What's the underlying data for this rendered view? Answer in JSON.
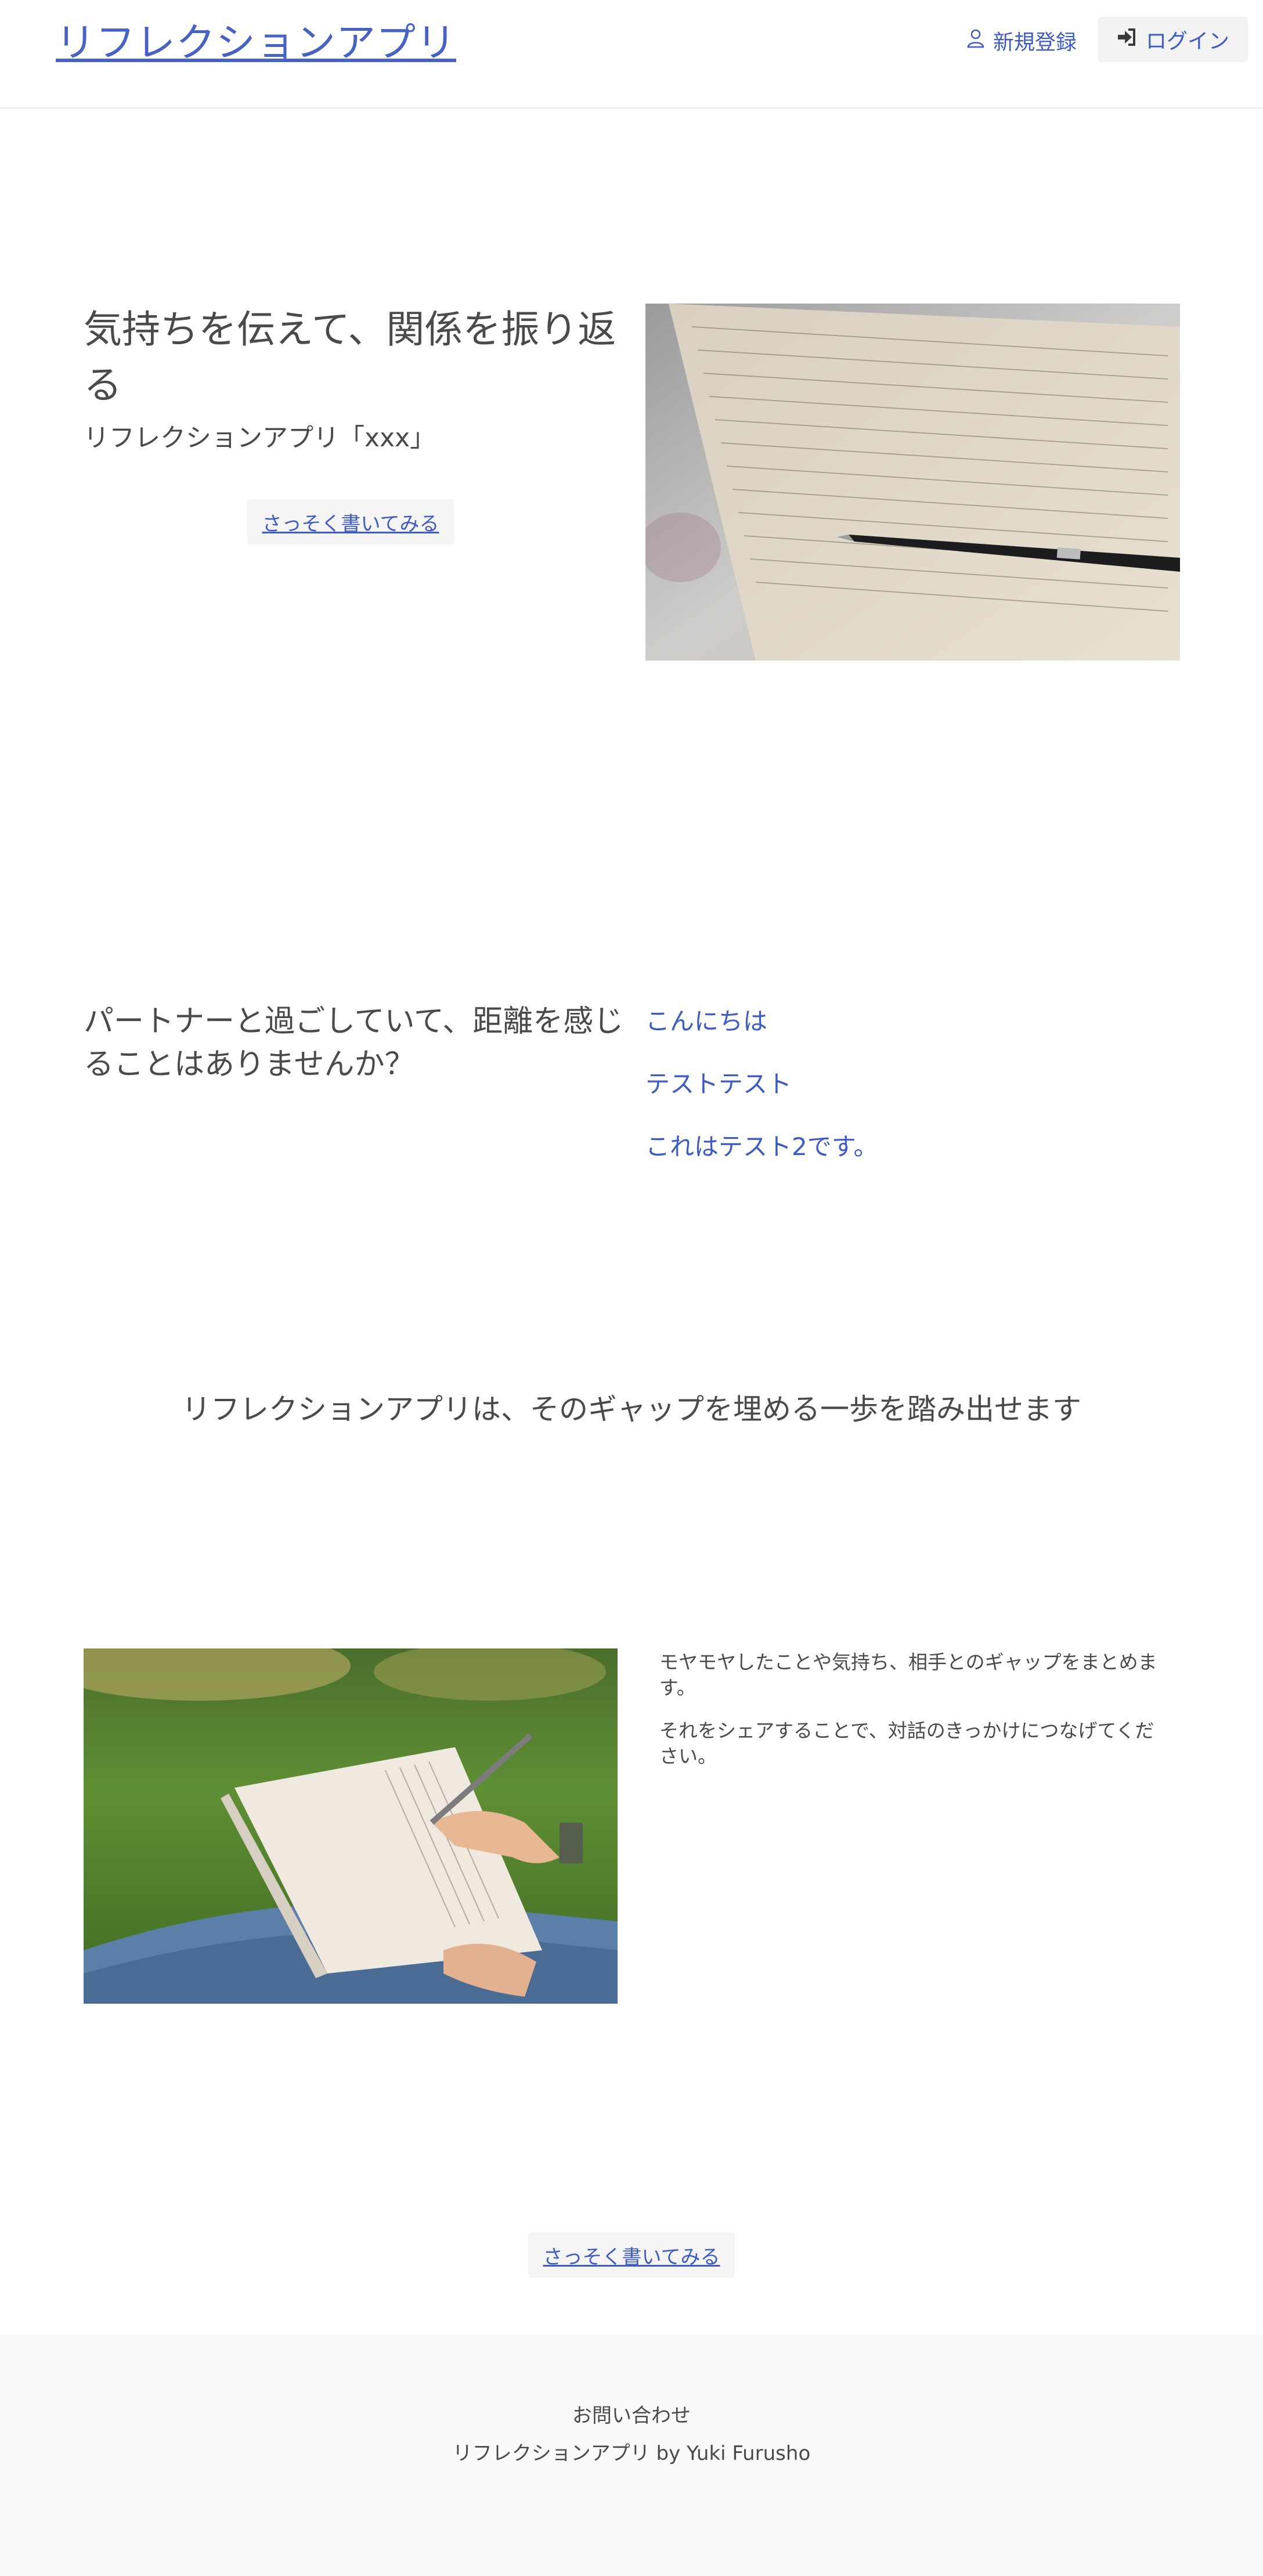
{
  "header": {
    "brand": "リフレクションアプリ",
    "signup_label": "新規登録",
    "signup_icon": "user-icon",
    "login_label": "ログイン",
    "login_icon": "sign-in-icon"
  },
  "hero": {
    "title": "気持ちを伝えて、関係を振り返る",
    "subtitle": "リフレクションアプリ「xxx」",
    "cta_label": "さっそく書いてみる",
    "image": "letter-and-pen-photo"
  },
  "question": {
    "text": "パートナーと過ごしていて、距離を感じることはありませんか？",
    "posts": [
      "こんにちは",
      "テストテスト",
      "これはテスト2です。"
    ]
  },
  "tagline": "リフレクションアプリは、そのギャップを埋める一歩を踏み出せます",
  "feature": {
    "image": "writing-notebook-photo",
    "paragraphs": [
      "モヤモヤしたことや気持ち、相手とのギャップをまとめます。",
      "それをシェアすることで、対話のきっかけにつなげてください。"
    ]
  },
  "bottom_cta_label": "さっそく書いてみる",
  "footer": {
    "contact": "お問い合わせ",
    "credit": "リフレクションアプリ by Yuki Furusho"
  },
  "colors": {
    "accent": "#3e5bc4",
    "text": "#4a4a4a",
    "button_bg": "#f4f4f5",
    "footer_bg": "#fafafa"
  }
}
